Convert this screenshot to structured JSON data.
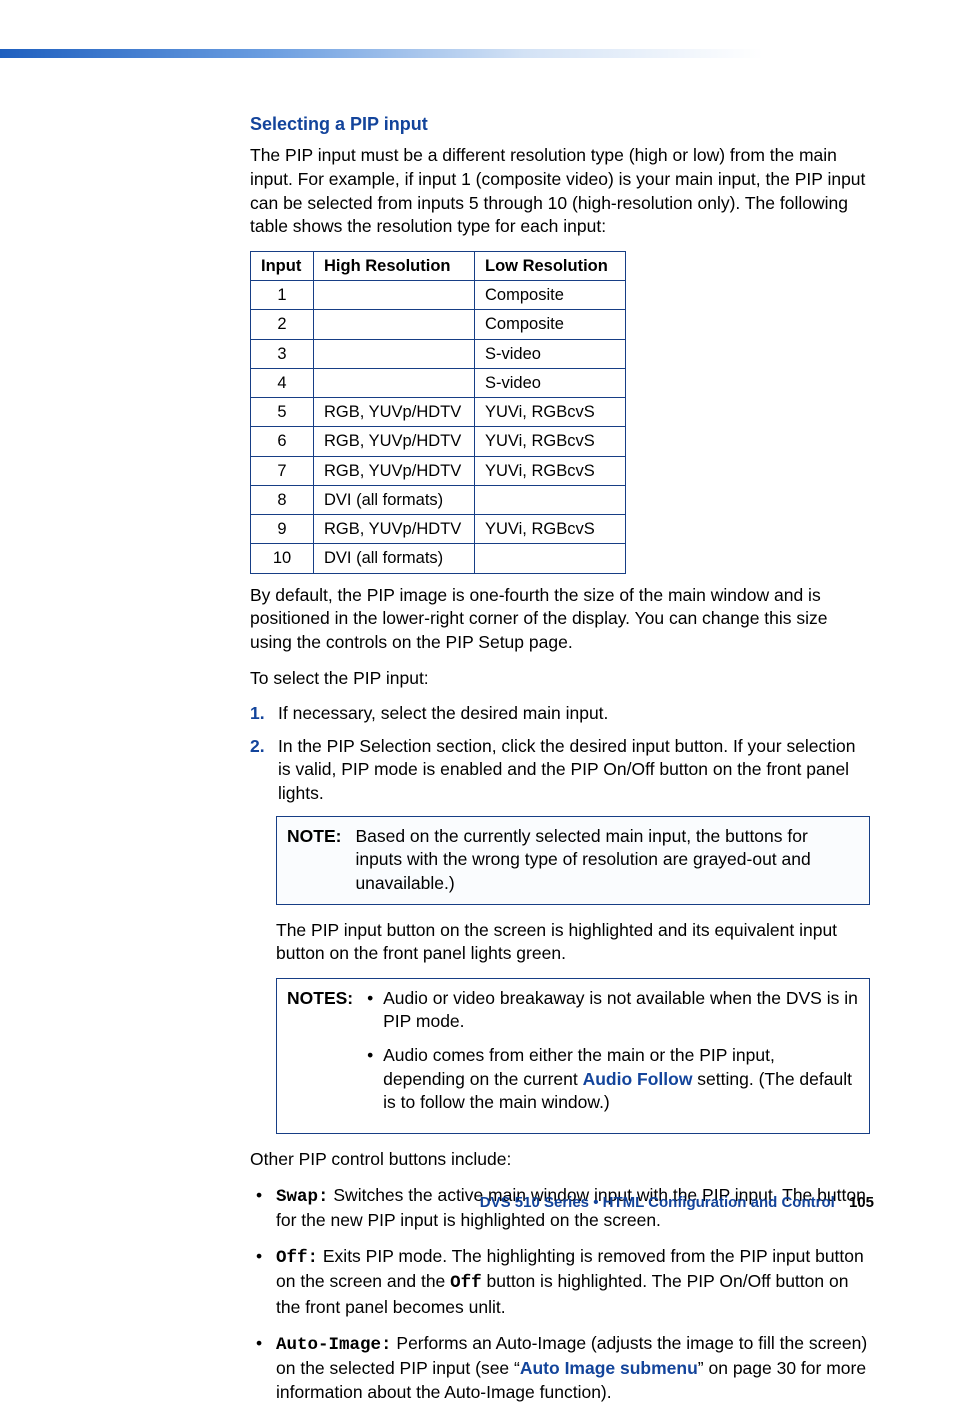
{
  "heading": "Selecting a PIP input",
  "intro": "The PIP input must be a different resolution type (high or low) from the main input. For example, if input 1 (composite video) is your main input, the PIP input can be selected from inputs 5 through 10 (high-resolution only). The following table shows the resolution type for each input:",
  "table": {
    "headers": [
      "Input",
      "High Resolution",
      "Low Resolution"
    ],
    "rows": [
      [
        "1",
        "",
        "Composite"
      ],
      [
        "2",
        "",
        "Composite"
      ],
      [
        "3",
        "",
        "S-video"
      ],
      [
        "4",
        "",
        "S-video"
      ],
      [
        "5",
        "RGB, YUVp/HDTV",
        "YUVi, RGBcvS"
      ],
      [
        "6",
        "RGB, YUVp/HDTV",
        "YUVi, RGBcvS"
      ],
      [
        "7",
        "RGB, YUVp/HDTV",
        "YUVi, RGBcvS"
      ],
      [
        "8",
        "DVI (all formats)",
        ""
      ],
      [
        "9",
        "RGB, YUVp/HDTV",
        "YUVi, RGBcvS"
      ],
      [
        "10",
        "DVI (all formats)",
        ""
      ]
    ]
  },
  "after_table": "By default, the PIP image is one-fourth the size of the main window and is positioned in the lower-right corner of the display. You can change this size using the controls on the PIP Setup page.",
  "select_intro": "To select the PIP input:",
  "steps": [
    "If necessary, select the desired main input.",
    "In the PIP Selection section, click the desired input button. If your selection is valid, PIP mode is enabled and the PIP On/Off button on the front panel lights."
  ],
  "note1_label": "NOTE:",
  "note1_text": "Based on the currently selected main input, the buttons for inputs with the wrong type of resolution are grayed-out and unavailable.)",
  "after_note1": "The PIP input button on the screen is highlighted and its equivalent input button on the front panel lights green.",
  "notes2_label": "NOTES:",
  "notes2_items": {
    "a": "Audio or video breakaway is not available when the DVS is in PIP mode.",
    "b_pre": "Audio comes from either the main or the PIP input, depending on the current ",
    "b_link": "Audio Follow",
    "b_post": " setting. (The default is to follow the main window.)"
  },
  "other_intro": "Other PIP control buttons include:",
  "bullets": {
    "swap_label": "Swap:",
    "swap_text": " Switches the active main window input with the PIP input. The button for the new PIP input is highlighted on the screen.",
    "off_label": "Off:",
    "off_text_pre": " Exits PIP mode. The highlighting is removed from the PIP input button on the screen and the ",
    "off_mono": "Off",
    "off_text_post": " button is highlighted. The PIP On/Off button on the front panel becomes unlit.",
    "auto_label": "Auto-Image:",
    "auto_pre": " Performs an Auto-Image (adjusts the image to fill the screen) on the selected PIP input (see “",
    "auto_link": "Auto Image submenu",
    "auto_post": "” on page 30 for more information about the Auto-Image function)."
  },
  "footer": {
    "title": "DVS 510 Series • HTML Configuration and Control",
    "page": "105"
  }
}
